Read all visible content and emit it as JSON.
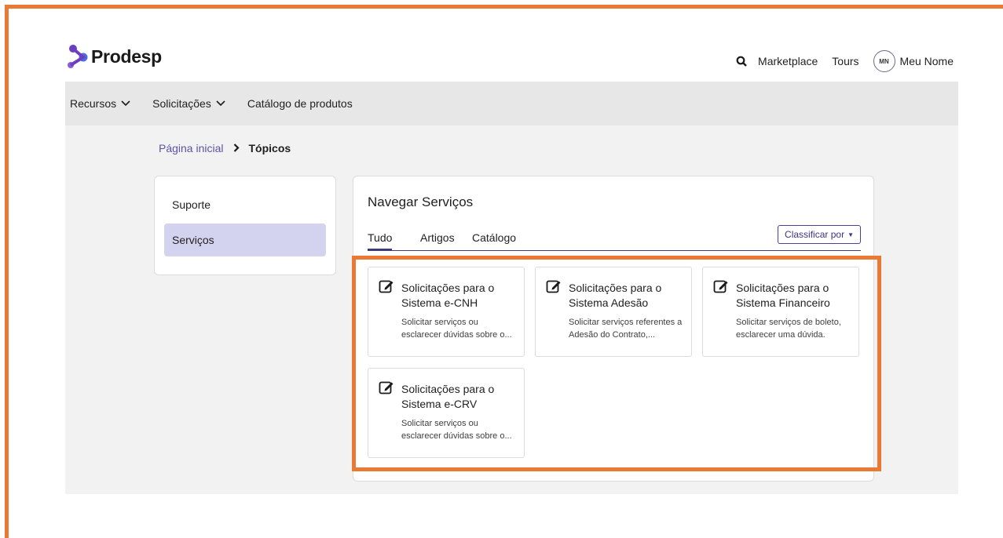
{
  "header": {
    "logo_text": "Prodesp",
    "links": [
      "Marketplace",
      "Tours"
    ],
    "avatar_initials": "MN",
    "user_name": "Meu Nome"
  },
  "nav": {
    "items": [
      {
        "label": "Recursos",
        "dropdown": true
      },
      {
        "label": "Solicitações",
        "dropdown": true
      },
      {
        "label": "Catálogo de produtos",
        "dropdown": false
      }
    ]
  },
  "breadcrumb": {
    "home": "Página inicial",
    "current": "Tópicos"
  },
  "sidebar": {
    "items": [
      {
        "label": "Suporte",
        "active": false
      },
      {
        "label": "Serviços",
        "active": true
      }
    ]
  },
  "main": {
    "title": "Navegar Serviços",
    "tabs": [
      {
        "label": "Tudo",
        "active": true
      },
      {
        "label": "Artigos",
        "active": false
      },
      {
        "label": "Catálogo",
        "active": false
      }
    ],
    "sort_label": "Classificar por",
    "cards": [
      {
        "title": "Solicitações para o Sistema e-CNH",
        "description": "Solicitar serviços ou esclarecer dúvidas sobre o..."
      },
      {
        "title": "Solicitações para o Sistema Adesão",
        "description": "Solicitar serviços referentes a Adesão do Contrato,..."
      },
      {
        "title": "Solicitações para o Sistema Financeiro",
        "description": "Solicitar serviços de boleto, esclarecer uma dúvida."
      },
      {
        "title": "Solicitações para o Sistema e-CRV",
        "description": "Solicitar serviços ou esclarecer dúvidas sobre o..."
      }
    ]
  },
  "colors": {
    "brand_purple": "#6b3fc0",
    "highlight_orange": "#ea7a33",
    "active_sidebar": "#d3d3ef"
  }
}
